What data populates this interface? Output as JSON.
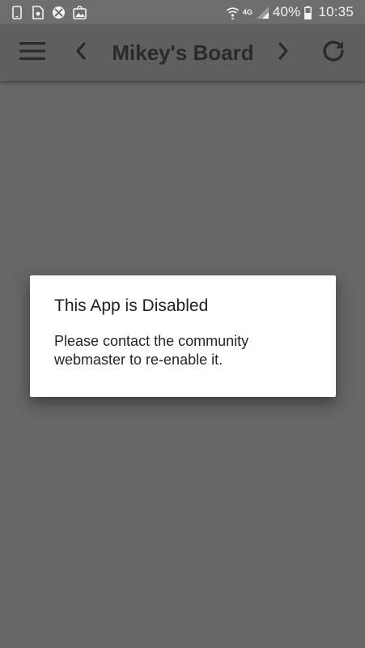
{
  "status_bar": {
    "notification_icons": [
      "phone-icon",
      "sim-icon",
      "no-sync-icon",
      "photo-icon"
    ],
    "network_type": "4G",
    "battery_percent": "40%",
    "time": "10:35"
  },
  "toolbar": {
    "title": "Mikey's Board"
  },
  "dialog": {
    "title": "This App is Disabled",
    "message": "Please contact the community webmaster to re-enable it."
  },
  "colors": {
    "dimmed_background": "#666666",
    "toolbar": "#5f5f5f",
    "dialog": "#ffffff"
  }
}
